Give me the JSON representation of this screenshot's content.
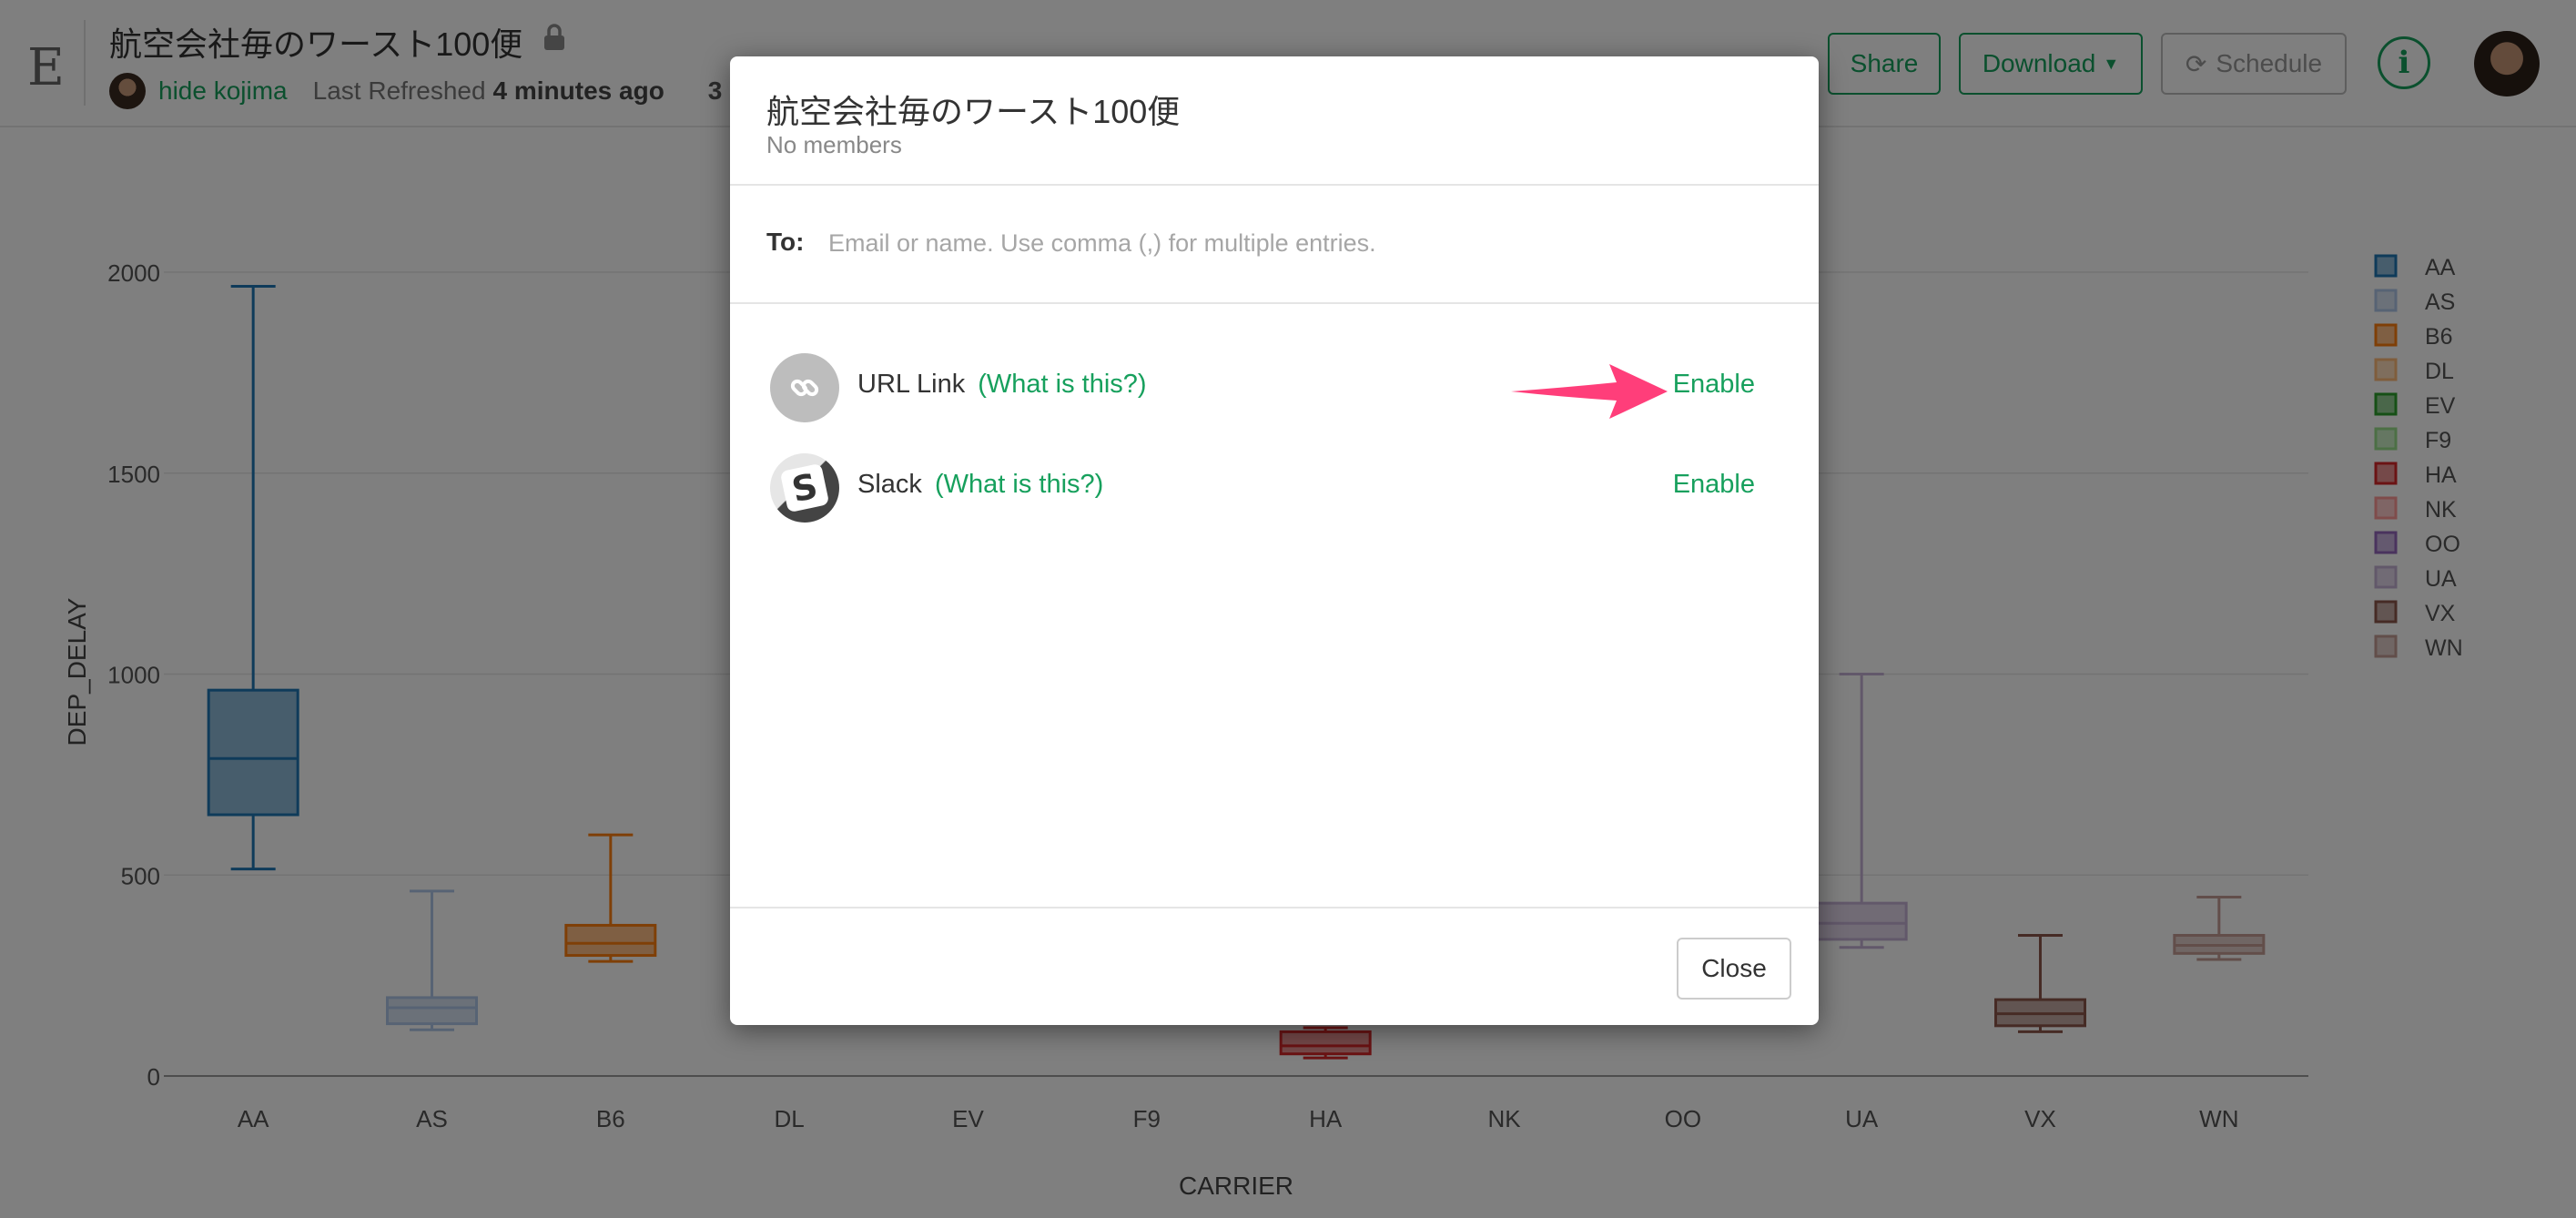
{
  "header": {
    "logo_letter": "E",
    "title": "航空会社毎のワースト100便",
    "owner_name": "hide kojima",
    "refresh_label": "Last Refreshed",
    "refresh_value": "4 minutes ago",
    "extra_count": "3",
    "share_label": "Share",
    "download_label": "Download",
    "schedule_label": "Schedule",
    "icons": {
      "lock": "lock-icon",
      "info": "info-icon",
      "schedule": "refresh-icon"
    }
  },
  "chart_data": {
    "type": "box",
    "xlabel": "CARRIER",
    "ylabel": "DEP_DELAY",
    "ylim": [
      0,
      2200
    ],
    "yticks": [
      0,
      500,
      1000,
      1500,
      2000
    ],
    "grid": true,
    "legend_position": "right",
    "categories": [
      "AA",
      "AS",
      "B6",
      "DL",
      "EV",
      "F9",
      "HA",
      "NK",
      "OO",
      "UA",
      "VX",
      "WN"
    ],
    "series": [
      {
        "name": "AA",
        "color": "#1f77b4",
        "min": 515,
        "q1": 650,
        "median": 790,
        "q3": 960,
        "max": 1965
      },
      {
        "name": "AS",
        "color": "#aec7e8",
        "min": 115,
        "q1": 130,
        "median": 170,
        "q3": 195,
        "max": 460
      },
      {
        "name": "B6",
        "color": "#ff7f0e",
        "min": 285,
        "q1": 300,
        "median": 330,
        "q3": 375,
        "max": 600
      },
      {
        "name": "DL",
        "color": "#ffbb78",
        "min": null,
        "q1": null,
        "median": null,
        "q3": null,
        "max": null
      },
      {
        "name": "EV",
        "color": "#2ca02c",
        "min": null,
        "q1": null,
        "median": null,
        "q3": null,
        "max": null
      },
      {
        "name": "F9",
        "color": "#98df8a",
        "min": null,
        "q1": null,
        "median": null,
        "q3": null,
        "max": null
      },
      {
        "name": "HA",
        "color": "#d62728",
        "min": 45,
        "q1": 55,
        "median": 75,
        "q3": 110,
        "max": 120
      },
      {
        "name": "NK",
        "color": "#ff9896",
        "min": null,
        "q1": null,
        "median": null,
        "q3": null,
        "max": null
      },
      {
        "name": "OO",
        "color": "#9467bd",
        "min": null,
        "q1": null,
        "median": null,
        "q3": null,
        "max": null
      },
      {
        "name": "UA",
        "color": "#c5b0d5",
        "min": 320,
        "q1": 340,
        "median": 380,
        "q3": 430,
        "max": 1000
      },
      {
        "name": "VX",
        "color": "#8c564b",
        "min": 110,
        "q1": 125,
        "median": 155,
        "q3": 190,
        "max": 350
      },
      {
        "name": "WN",
        "color": "#c49c94",
        "min": 290,
        "q1": 305,
        "median": 325,
        "q3": 350,
        "max": 445
      }
    ]
  },
  "modal": {
    "title": "航空会社毎のワースト100便",
    "subtitle": "No members",
    "to_label": "To:",
    "to_placeholder": "Email or name. Use comma (,) for multiple entries.",
    "integrations": [
      {
        "name": "URL Link",
        "help": "(What is this?)",
        "action": "Enable",
        "icon": "link-icon"
      },
      {
        "name": "Slack",
        "help": "(What is this?)",
        "action": "Enable",
        "icon": "slack-icon"
      }
    ],
    "close_label": "Close",
    "accent_color": "#17a05d",
    "callout_color": "#ff3e7a"
  }
}
